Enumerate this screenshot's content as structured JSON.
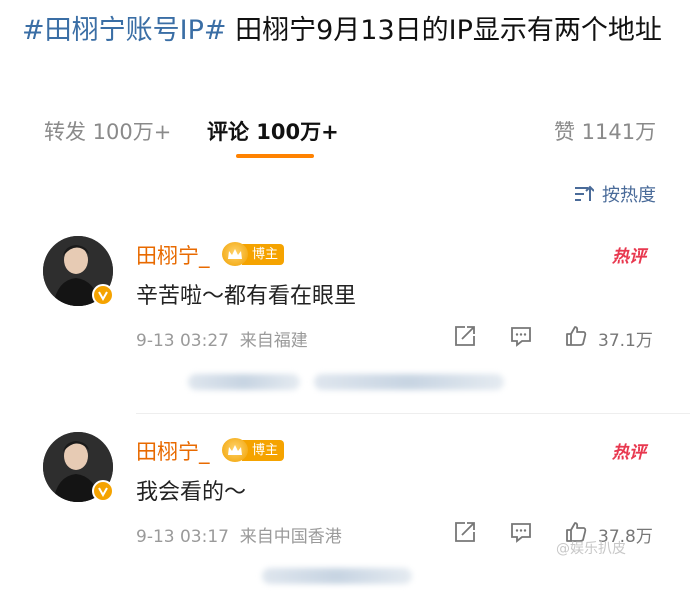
{
  "post": {
    "hashtag": "#田栩宁账号IP#",
    "title_text": " 田栩宁9月13日的IP显示有两个地址"
  },
  "tabs": [
    {
      "label": "转发 100万+"
    },
    {
      "label": "评论 100万+"
    },
    {
      "label": "赞 1141万"
    }
  ],
  "sort": {
    "label": "按热度"
  },
  "comments": [
    {
      "username": "田栩宁_",
      "badge": "博主",
      "hot_tag": "热评",
      "content": "辛苦啦～都有看在眼里",
      "time": "9-13 03:27",
      "location": "来自福建",
      "likes": "37.1万"
    },
    {
      "username": "田栩宁_",
      "badge": "博主",
      "hot_tag": "热评",
      "content": "我会看的～",
      "time": "9-13 03:17",
      "location": "来自中国香港",
      "likes": "37.8万"
    }
  ],
  "watermark": "@娱乐扒皮",
  "colors": {
    "accent": "#ff8200",
    "hashtag": "#3a6ea5",
    "username": "#e86a00",
    "hot": "#e8384f"
  }
}
